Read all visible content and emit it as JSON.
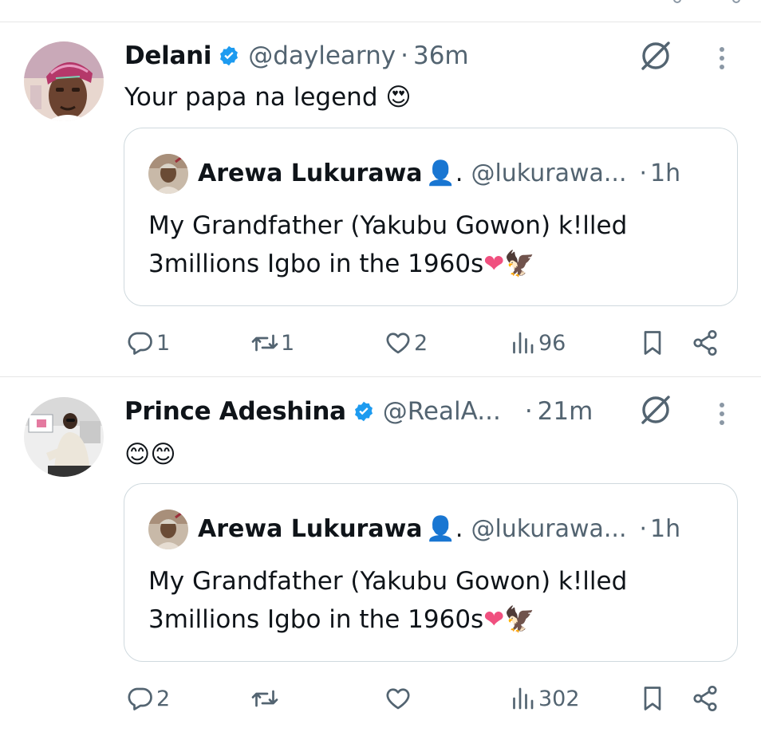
{
  "colors": {
    "text_primary": "#0f1419",
    "text_secondary": "#536471",
    "verified_blue": "#1d9bf0",
    "border": "#cfd9de",
    "heart_emoji": "#f0507f"
  },
  "tweets": [
    {
      "author": {
        "name": "Delani",
        "verified": true,
        "handle": "@daylearny",
        "dot": "·",
        "time": "36m"
      },
      "text": "Your papa na legend",
      "emoji": "😍",
      "quote": {
        "author_name": "Arewa Lukurawa",
        "author_emoji": "👤.",
        "handle": "@lukurawa...",
        "dot": "·",
        "time": "1h",
        "text_line1": "My Grandfather (Yakubu Gowon) k!lled",
        "text_line2": "3millions Igbo in the 1960s",
        "text_emojis": "❤🦅"
      },
      "actions": {
        "replies": "1",
        "reposts": "1",
        "likes": "2",
        "views": "96"
      }
    },
    {
      "author": {
        "name": "Prince Adeshina",
        "verified": true,
        "handle": "@RealA...",
        "dot": "·",
        "time": "21m"
      },
      "text": "",
      "emoji": "😊😊",
      "quote": {
        "author_name": "Arewa Lukurawa",
        "author_emoji": "👤.",
        "handle": "@lukurawa...",
        "dot": "·",
        "time": "1h",
        "text_line1": "My Grandfather (Yakubu Gowon) k!lled",
        "text_line2": "3millions Igbo in the 1960s",
        "text_emojis": "❤🦅"
      },
      "actions": {
        "replies": "2",
        "reposts": "",
        "likes": "",
        "views": "302"
      }
    }
  ]
}
